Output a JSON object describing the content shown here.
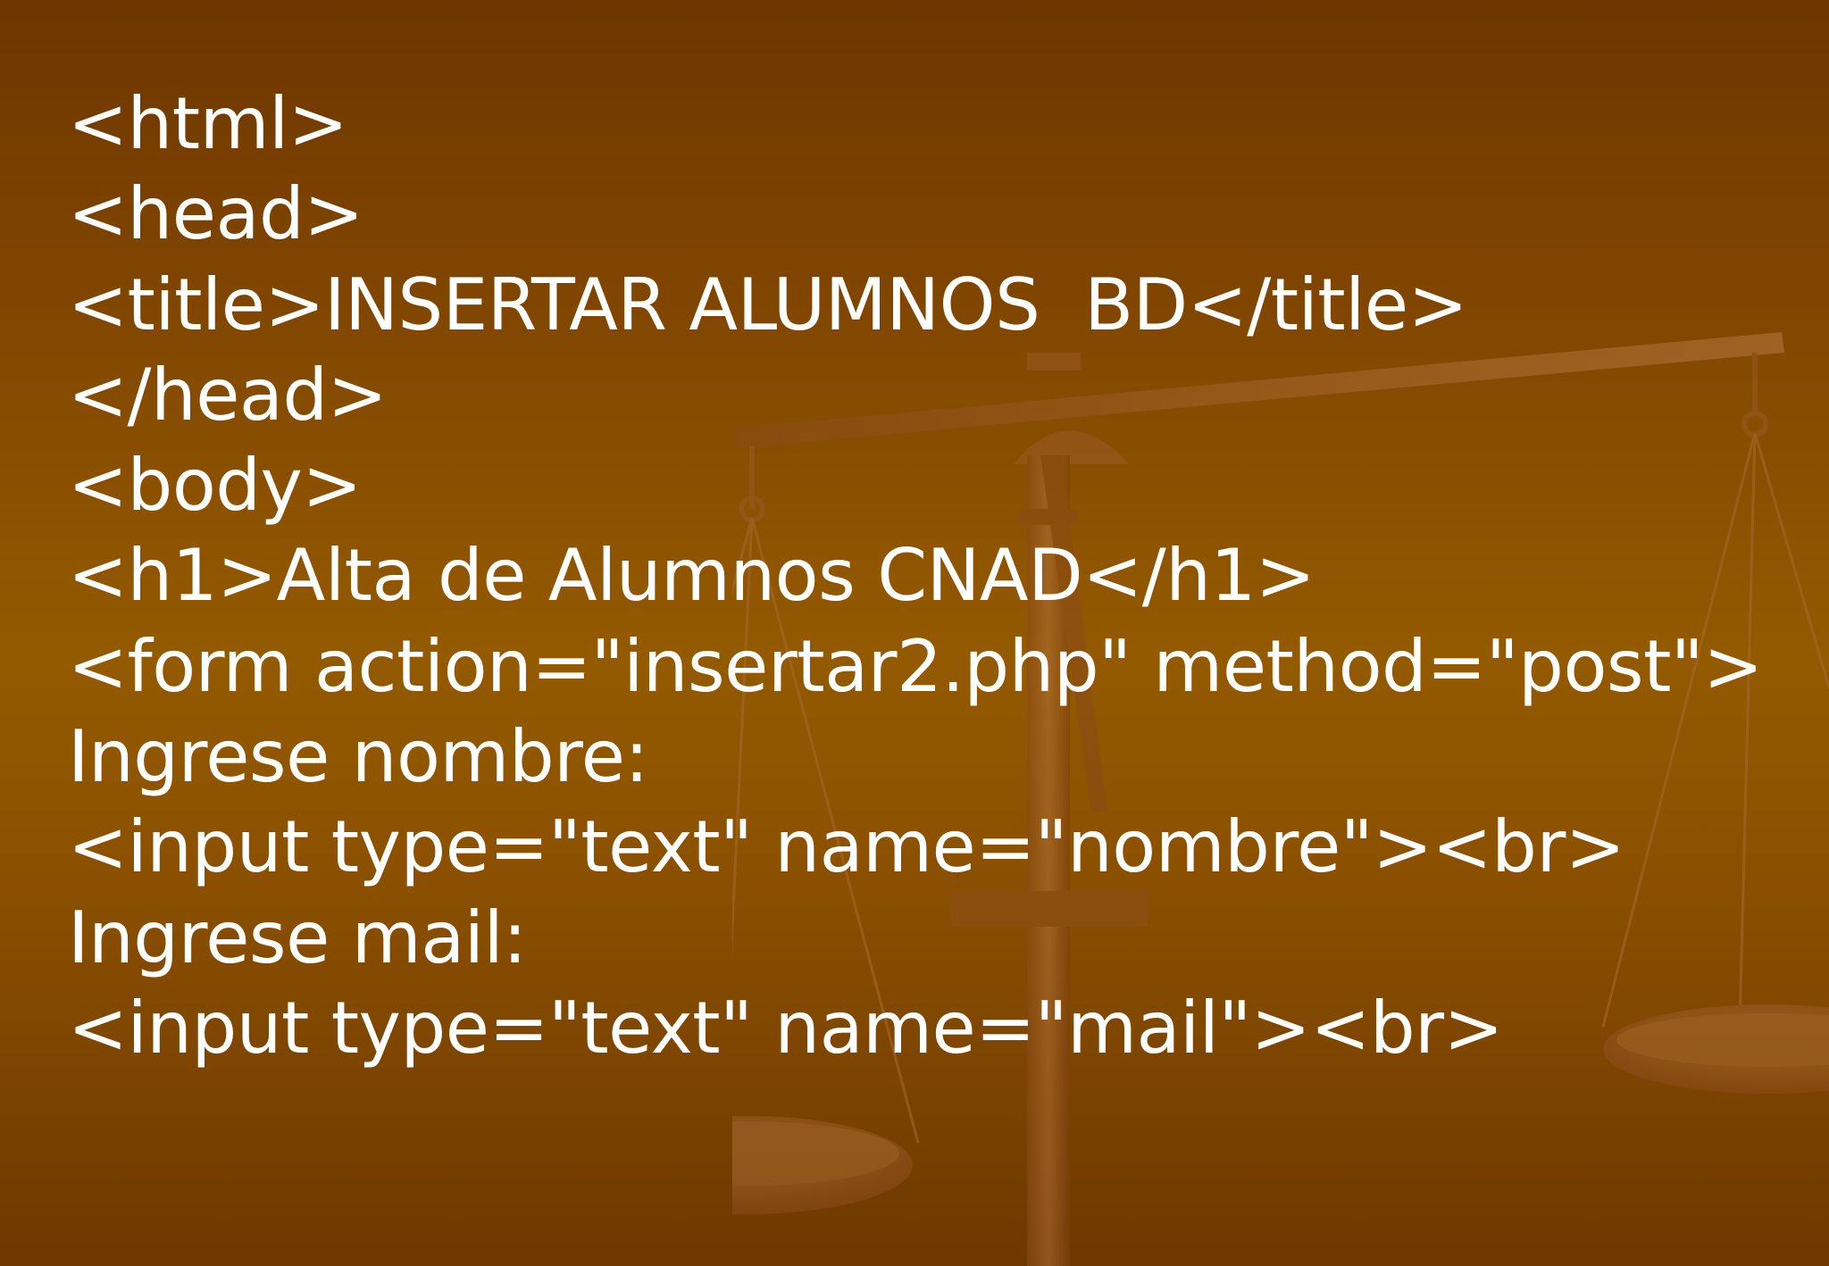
{
  "slide": {
    "lines": [
      "<html>",
      "<head>",
      "<title>INSERTAR ALUMNOS  BD</title>",
      "</head>",
      "<body>",
      "<h1>Alta de Alumnos CNAD</h1>",
      "<form action=\"insertar2.php\" method=\"post\">",
      "Ingrese nombre:",
      "<input type=\"text\" name=\"nombre\"><br>",
      "Ingrese mail:",
      "<input type=\"text\" name=\"mail\"><br>"
    ]
  },
  "colors": {
    "background_top": "#6e3600",
    "background_mid": "#945a00",
    "text": "#ffffff",
    "illustration": "#a0622a"
  },
  "decoration": {
    "icon": "balance-scale-icon"
  }
}
